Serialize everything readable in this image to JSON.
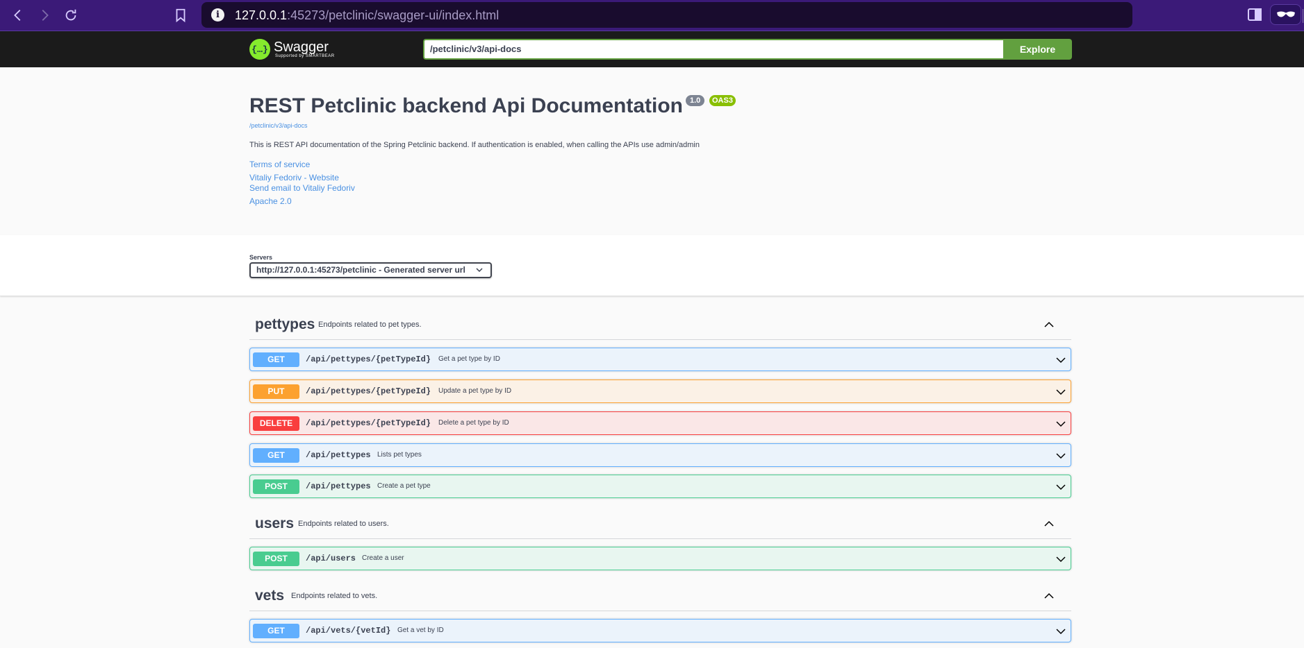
{
  "browser": {
    "url_host": "127.0.0.1",
    "url_rest": ":45273/petclinic/swagger-ui/index.html"
  },
  "topbar": {
    "logo_name": "Swagger",
    "logo_sub": "Supported by SMARTBEAR",
    "spec_url": "/petclinic/v3/api-docs",
    "explore_label": "Explore"
  },
  "info": {
    "title": "REST Petclinic backend Api Documentation",
    "version": "1.0",
    "oas": "OAS3",
    "spec_link": "/petclinic/v3/api-docs",
    "description": "This is REST API documentation of the Spring Petclinic backend. If authentication is enabled, when calling the APIs use admin/admin",
    "terms": "Terms of service",
    "website": "Vitaliy Fedoriv - Website",
    "email": "Send email to Vitaliy Fedoriv",
    "license": "Apache 2.0"
  },
  "servers": {
    "label": "Servers",
    "selected": "http://127.0.0.1:45273/petclinic - Generated server url"
  },
  "tags": [
    {
      "name": "pettypes",
      "description": "Endpoints related to pet types.",
      "operations": [
        {
          "method": "GET",
          "path": "/api/pettypes/{petTypeId}",
          "summary": "Get a pet type by ID"
        },
        {
          "method": "PUT",
          "path": "/api/pettypes/{petTypeId}",
          "summary": "Update a pet type by ID"
        },
        {
          "method": "DELETE",
          "path": "/api/pettypes/{petTypeId}",
          "summary": "Delete a pet type by ID"
        },
        {
          "method": "GET",
          "path": "/api/pettypes",
          "summary": "Lists pet types"
        },
        {
          "method": "POST",
          "path": "/api/pettypes",
          "summary": "Create a pet type"
        }
      ]
    },
    {
      "name": "users",
      "description": "Endpoints related to users.",
      "operations": [
        {
          "method": "POST",
          "path": "/api/users",
          "summary": "Create a user"
        }
      ]
    },
    {
      "name": "vets",
      "description": "Endpoints related to vets.",
      "operations": [
        {
          "method": "GET",
          "path": "/api/vets/{vetId}",
          "summary": "Get a vet by ID"
        }
      ]
    }
  ],
  "colors": {
    "get": "#61affe",
    "put": "#fca130",
    "delete": "#f93e3e",
    "post": "#49cc90",
    "explore": "#62a03f",
    "link": "#4990e2"
  }
}
